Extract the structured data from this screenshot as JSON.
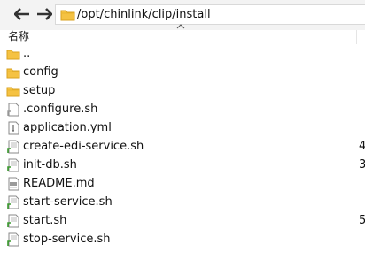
{
  "address": {
    "path": "/opt/chinlink/clip/install"
  },
  "columns": {
    "name": "名称"
  },
  "files": [
    {
      "name": "..",
      "type": "folder-up",
      "size": ""
    },
    {
      "name": "config",
      "type": "folder",
      "size": ""
    },
    {
      "name": "setup",
      "type": "folder",
      "size": ""
    },
    {
      "name": ".configure.sh",
      "type": "script-gray",
      "size": ""
    },
    {
      "name": "application.yml",
      "type": "text",
      "size": ""
    },
    {
      "name": "create-edi-service.sh",
      "type": "script",
      "size": "4"
    },
    {
      "name": "init-db.sh",
      "type": "script",
      "size": "3"
    },
    {
      "name": "README.md",
      "type": "markdown",
      "size": ""
    },
    {
      "name": "start-service.sh",
      "type": "script",
      "size": ""
    },
    {
      "name": "start.sh",
      "type": "script",
      "size": "5"
    },
    {
      "name": "stop-service.sh",
      "type": "script",
      "size": ""
    }
  ],
  "colors": {
    "folder": "#f5c242",
    "script_accent": "#3a9a2e",
    "toolbar_bg": "#f3f3f3"
  }
}
